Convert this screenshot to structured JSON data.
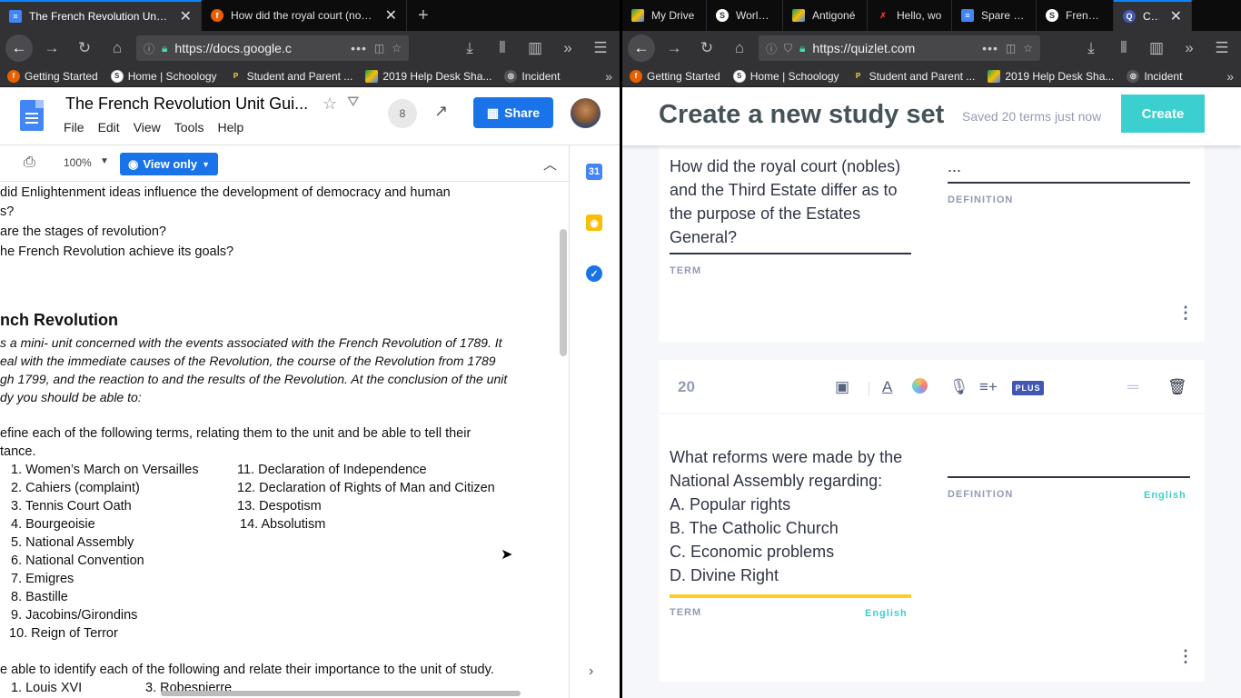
{
  "left": {
    "tabs": [
      {
        "title": "The French Revolution Unit Guide",
        "icon": "google-docs-icon",
        "active": true
      },
      {
        "title": "How did the royal court (nobles",
        "icon": "firefox-icon",
        "active": false
      }
    ],
    "url": "https://docs.google.c",
    "bookmarks": [
      "Getting Started",
      "Home | Schoology",
      "Student and Parent ...",
      "2019 Help Desk Sha...",
      "Incident"
    ],
    "doc": {
      "title": "The French Revolution Unit Gui...",
      "menu": [
        "File",
        "Edit",
        "View",
        "Tools",
        "Help"
      ],
      "comments_count": "8",
      "share_label": "Share",
      "zoom": "100%",
      "view_mode": "View only",
      "lines": {
        "q1a": "did Enlightenment ideas influence the development of democracy and human",
        "q1b": "s?",
        "q2": " are the stages of revolution?",
        "q3": "he French Revolution achieve its goals?",
        "heading": "nch Revolution",
        "p1": "s a mini- unit concerned with the events associated with the French Revolution of 1789.  It",
        "p2": "eal with the immediate causes of the Revolution, the course of the Revolution from 1789",
        "p3": "gh 1799, and the reaction to and the results of the Revolution. At the conclusion of the unit",
        "p4": "dy you should be able to:",
        "def1": "efine each of the following terms, relating them to the unit and be able to tell their",
        "def2": "tance.",
        "ident": "e able to identify each of the following and relate their importance to the unit of study."
      },
      "terms_left": [
        "1. Women’s March on Versailles",
        "2.  Cahiers (complaint)",
        "3.  Tennis Court Oath",
        "4.  Bourgeoisie",
        "5.  National Assembly",
        "6.  National Convention",
        "7.   Emigres",
        "8.  Bastille",
        "9. Jacobins/Girondins",
        "10.  Reign of Terror"
      ],
      "terms_right": [
        "11. Declaration of Independence",
        "12.  Declaration of Rights of Man and Citizen",
        "13.  Despotism",
        "14. Absolutism"
      ],
      "people": [
        "1.  Louis XVI",
        "3.  Robespierre"
      ]
    }
  },
  "right": {
    "tabs": [
      {
        "title": "My Drive",
        "icon": "google-drive-icon"
      },
      {
        "title": "World His",
        "icon": "schoology-icon"
      },
      {
        "title": "Antigoné",
        "icon": "google-drive-icon"
      },
      {
        "title": "Hello, wo",
        "icon": "person-icon"
      },
      {
        "title": "Spare Kin",
        "icon": "google-docs-icon"
      },
      {
        "title": "French Re",
        "icon": "schoology-icon"
      },
      {
        "title": "Creat",
        "icon": "quizlet-icon",
        "active": true
      }
    ],
    "url": "https://quizlet.com",
    "bookmarks": [
      "Getting Started",
      "Home | Schoology",
      "Student and Parent ...",
      "2019 Help Desk Sha...",
      "Incident"
    ],
    "quizlet": {
      "page_title": "Create a new study set",
      "saved_status": "Saved 20 terms just now",
      "create_label": "Create",
      "card19": {
        "term_lines": [
          "How did the royal court (nobles)",
          "and the Third Estate differ as to",
          "the purpose of the Estates",
          "General?"
        ],
        "definition": "...",
        "term_label": "TERM",
        "definition_label": "DEFINITION"
      },
      "card20": {
        "number": "20",
        "plus_label": "PLUS",
        "term_lines": [
          "What reforms were made by the",
          "National Assembly regarding:",
          "A. Popular rights",
          "B. The Catholic Church",
          "C. Economic problems",
          "D. Divine Right"
        ],
        "term_label": "TERM",
        "definition_label": "DEFINITION",
        "term_lang": "English",
        "definition_lang": "English"
      }
    }
  },
  "colors": {
    "share_blue": "#1a73e8",
    "quizlet_teal": "#3ccfcf",
    "quizlet_plus": "#4257b2",
    "term_underline_active": "#ffcd1f"
  }
}
